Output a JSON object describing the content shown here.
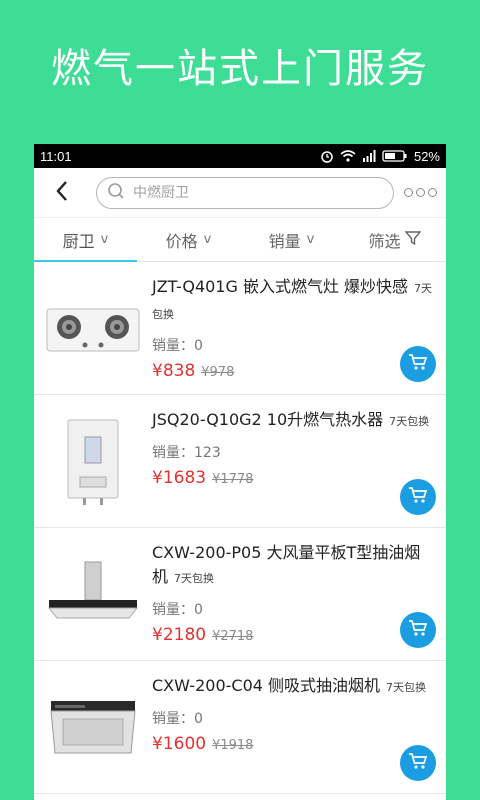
{
  "promo": {
    "title": "燃气一站式上门服务"
  },
  "status_bar": {
    "time": "11:01",
    "battery": "52%"
  },
  "app_bar": {
    "search_placeholder": "中燃厨卫",
    "icons": {
      "back": "chevron-left-icon",
      "search": "search-icon",
      "more": "more-dots-icon"
    }
  },
  "filters": {
    "tabs": [
      {
        "label": "厨卫",
        "suffix": "v"
      },
      {
        "label": "价格",
        "suffix": "v"
      },
      {
        "label": "销量",
        "suffix": "v"
      },
      {
        "label": "筛选",
        "icon": "filter-funnel-icon"
      }
    ]
  },
  "colors": {
    "background": "#3ddd96",
    "accent": "#3ac8e6",
    "price": "#e33232",
    "cart": "#1b9de2"
  },
  "products": [
    {
      "name": "JZT-Q401G 嵌入式燃气灶 爆炒快感",
      "tag": "7天包换",
      "sales": "销量：0",
      "price": "¥838",
      "old_price": "¥978"
    },
    {
      "name": "JSQ20-Q10G2 10升燃气热水器",
      "tag": "7天包换",
      "sales": "销量：123",
      "price": "¥1683",
      "old_price": "¥1778"
    },
    {
      "name": "CXW-200-P05 大风量平板T型抽油烟机",
      "tag": "7天包换",
      "sales": "销量：0",
      "price": "¥2180",
      "old_price": "¥2718"
    },
    {
      "name": "CXW-200-C04 侧吸式抽油烟机",
      "tag": "7天包换",
      "sales": "销量：0",
      "price": "¥1600",
      "old_price": "¥1918"
    }
  ]
}
